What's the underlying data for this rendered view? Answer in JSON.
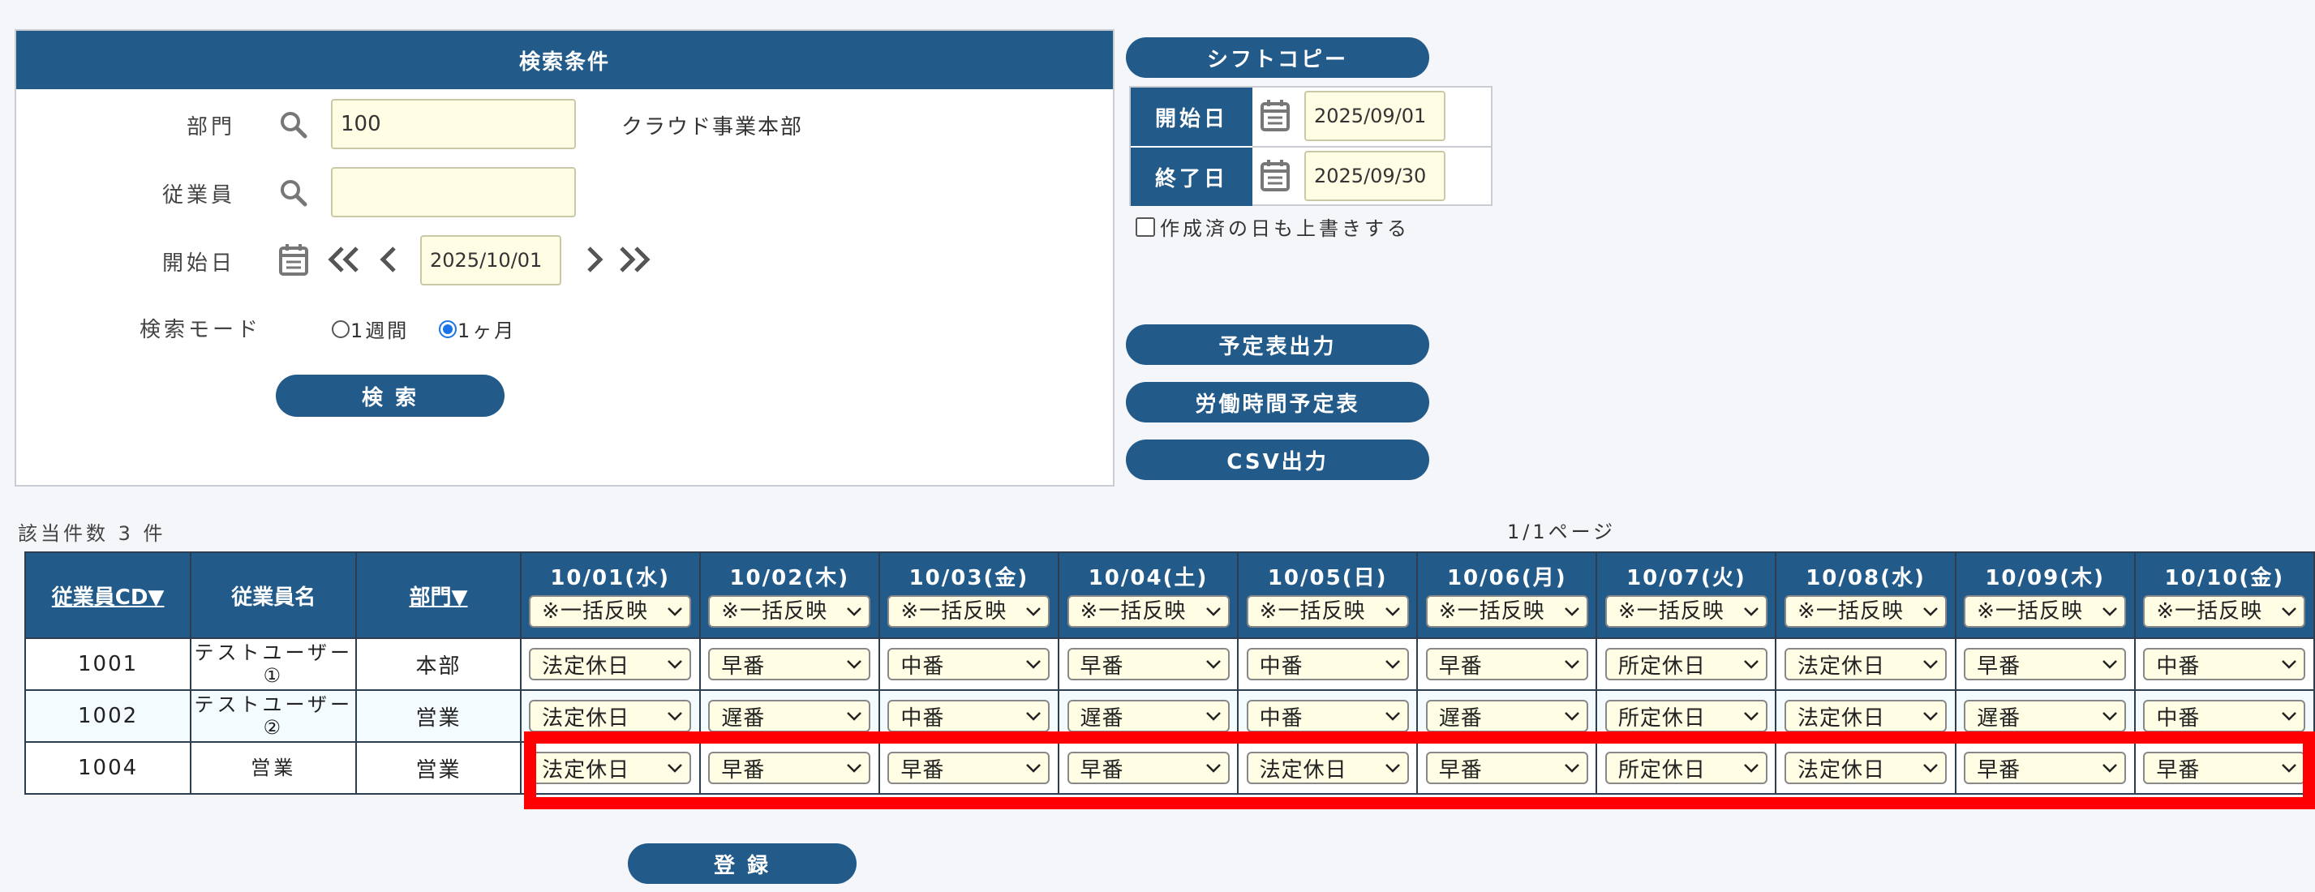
{
  "search": {
    "title": "検索条件",
    "dept_label": "部門",
    "dept_value": "100",
    "dept_name": "クラウド事業本部",
    "employee_label": "従業員",
    "employee_value": "",
    "start_label": "開始日",
    "start_value": "2025/10/01",
    "mode_label": "検索モード",
    "mode_week": "1週間",
    "mode_month": "1ヶ月",
    "mode_selected": "1ヶ月",
    "search_button": "検 索"
  },
  "copy": {
    "button": "シフトコピー",
    "start_label": "開始日",
    "start_value": "2025/09/01",
    "end_label": "終了日",
    "end_value": "2025/09/30",
    "overwrite_label": "作成済の日も上書きする"
  },
  "actions": {
    "schedule_output": "予定表出力",
    "labor_schedule": "労働時間予定表",
    "csv_output": "CSV出力"
  },
  "result": {
    "count": "該当件数 3 件",
    "page": "1/1ページ"
  },
  "table": {
    "headers": {
      "emp_cd": "従業員CD▼",
      "emp_name": "従業員名",
      "dept": "部門▼"
    },
    "bulk_label": "※一括反映",
    "dates": [
      "10/01(水)",
      "10/02(木)",
      "10/03(金)",
      "10/04(土)",
      "10/05(日)",
      "10/06(月)",
      "10/07(火)",
      "10/08(水)",
      "10/09(木)",
      "10/10(金)"
    ],
    "rows": [
      {
        "cd": "1001",
        "name": "テストユーザー①",
        "dept": "本部",
        "shifts": [
          "法定休日",
          "早番",
          "中番",
          "早番",
          "中番",
          "早番",
          "所定休日",
          "法定休日",
          "早番",
          "中番"
        ]
      },
      {
        "cd": "1002",
        "name": "テストユーザー②",
        "dept": "営業",
        "shifts": [
          "法定休日",
          "遅番",
          "中番",
          "遅番",
          "中番",
          "遅番",
          "所定休日",
          "法定休日",
          "遅番",
          "中番"
        ]
      },
      {
        "cd": "1004",
        "name": "営業",
        "dept": "営業",
        "shifts": [
          "法定休日",
          "早番",
          "早番",
          "早番",
          "法定休日",
          "早番",
          "所定休日",
          "法定休日",
          "早番",
          "早番"
        ]
      }
    ]
  },
  "register_button": "登 録",
  "colors": {
    "primary": "#225a8a",
    "input_bg": "#fffde4",
    "highlight": "#ff0000"
  }
}
